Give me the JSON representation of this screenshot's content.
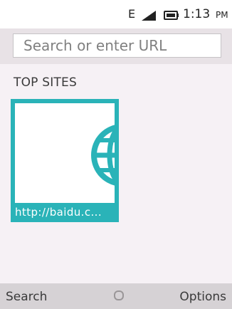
{
  "status_bar": {
    "network": "E",
    "time": "1:13",
    "ampm": "PM",
    "icons": [
      "signal-icon",
      "battery-icon"
    ]
  },
  "url_bar": {
    "placeholder": "Search or enter URL"
  },
  "top_sites": {
    "heading": "TOP SITES",
    "tiles": [
      {
        "label": "http://baidu.c...",
        "icon": "globe-icon"
      }
    ]
  },
  "softkeys": {
    "left": "Search",
    "center_icon": "circle-icon",
    "right": "Options"
  },
  "colors": {
    "accent": "#2ab3b8",
    "background": "#f6f1f5",
    "softkey_bar": "#d6d2d5"
  }
}
